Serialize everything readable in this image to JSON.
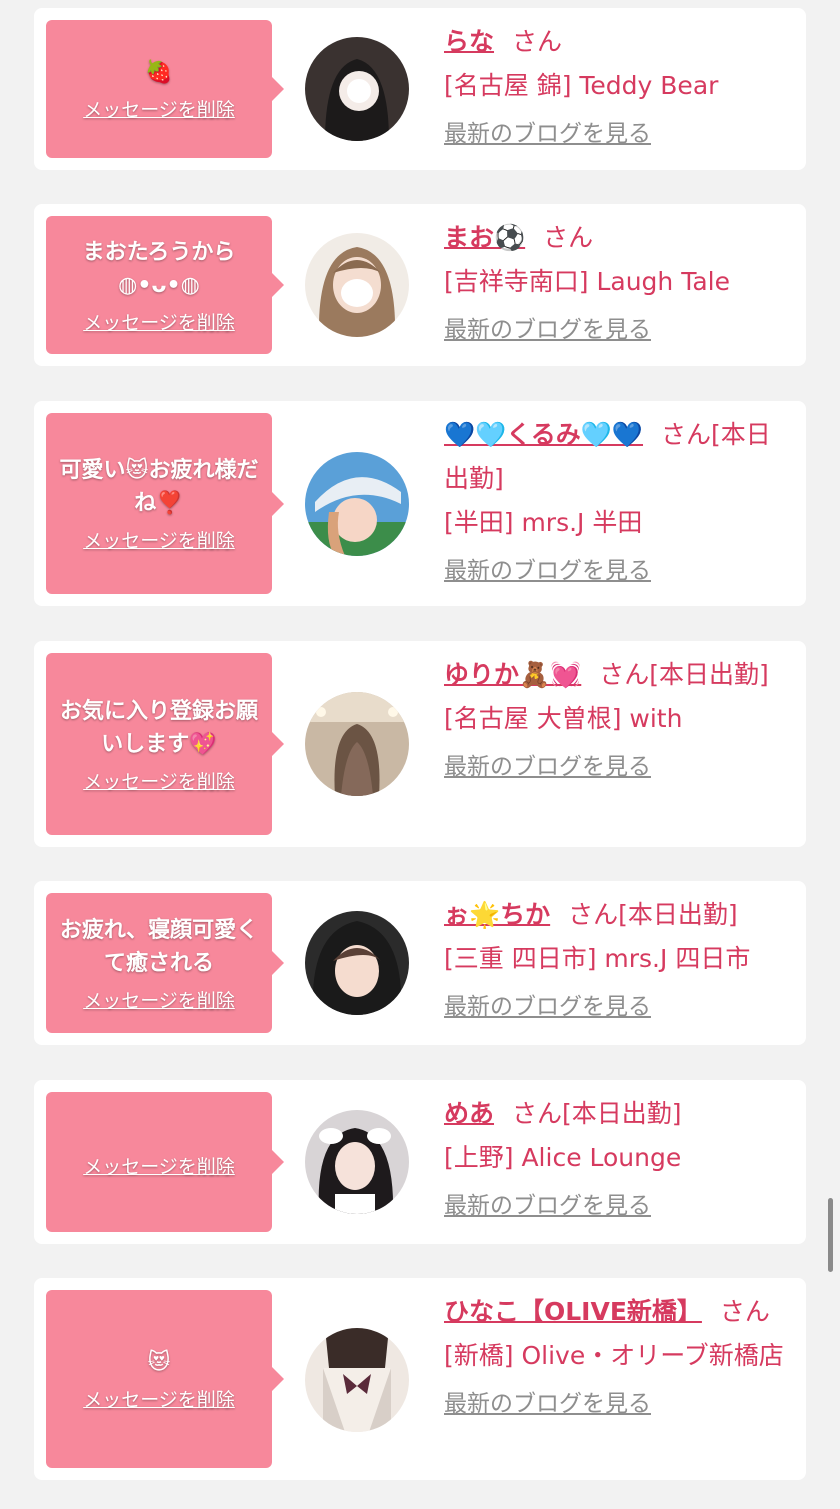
{
  "colors": {
    "bubble": "#f7889b",
    "name": "#d63a5f",
    "link_gray": "#8e8e8e",
    "page_bg": "#f2f2f2"
  },
  "entries": [
    {
      "message": "🍓",
      "delete_label": "メッセージを削除",
      "name": "らな",
      "honorific": "さん",
      "shop": "[名古屋 錦] Teddy Bear",
      "blog_label": "最新のブログを見る"
    },
    {
      "message": "まおたろうから◍•ᴗ•◍",
      "delete_label": "メッセージを削除",
      "name": "まお⚽",
      "honorific": "さん",
      "shop": "[吉祥寺南口] Laugh Tale",
      "blog_label": "最新のブログを見る"
    },
    {
      "message": "可愛い😻お疲れ様だね❣️",
      "delete_label": "メッセージを削除",
      "name": "💙🩵くるみ🩵💙",
      "honorific": "さん[本日出勤]",
      "shop": "[半田] mrs.J 半田",
      "blog_label": "最新のブログを見る"
    },
    {
      "message": "お気に入り登録お願いします💖",
      "delete_label": "メッセージを削除",
      "name": "ゆりか🧸💓",
      "honorific": "さん[本日出勤]",
      "shop": "[名古屋 大曽根] with",
      "blog_label": "最新のブログを見る"
    },
    {
      "message": "お疲れ、寝顔可愛くて癒される",
      "delete_label": "メッセージを削除",
      "name": "ぉ🌟ちか",
      "honorific": "さん[本日出勤]",
      "shop": "[三重 四日市] mrs.J 四日市",
      "blog_label": "最新のブログを見る"
    },
    {
      "message": "",
      "delete_label": "メッセージを削除",
      "name": "めあ",
      "honorific": "さん[本日出勤]",
      "shop": "[上野] Alice Lounge",
      "blog_label": "最新のブログを見る"
    },
    {
      "message": "😻",
      "delete_label": "メッセージを削除",
      "name": "ひなこ【OLIVE新橋】",
      "honorific": "さん",
      "shop": "[新橋] Olive・オリーブ新橋店",
      "blog_label": "最新のブログを見る"
    }
  ]
}
